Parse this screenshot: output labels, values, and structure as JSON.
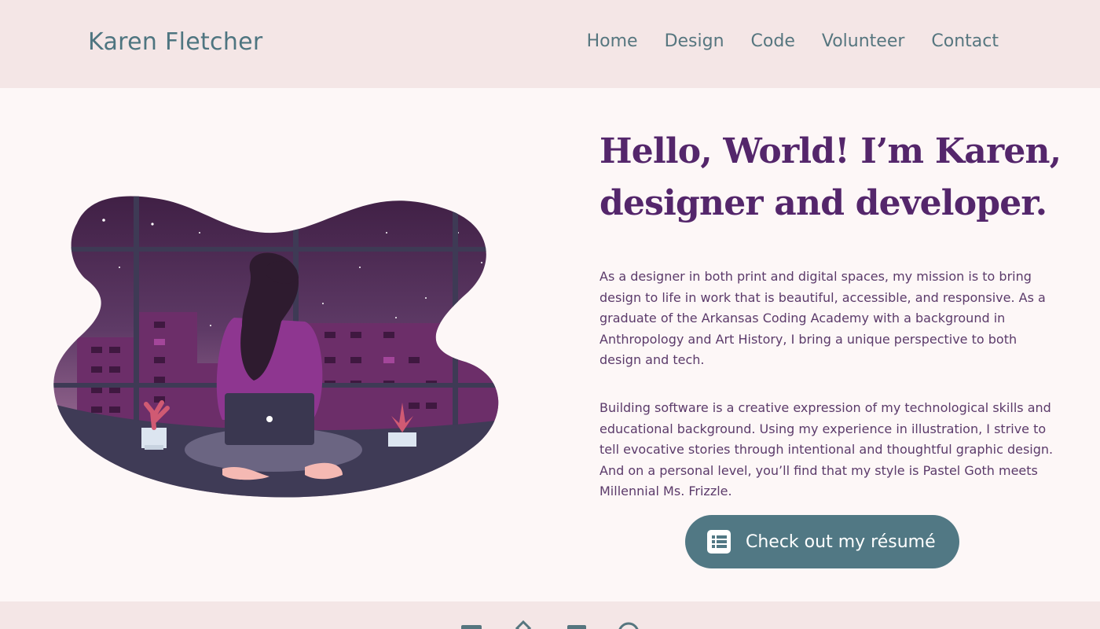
{
  "header": {
    "brand": "Karen Fletcher",
    "nav": [
      {
        "label": "Home"
      },
      {
        "label": "Design"
      },
      {
        "label": "Code"
      },
      {
        "label": "Volunteer"
      },
      {
        "label": "Contact"
      }
    ]
  },
  "hero": {
    "illustration": "woman-with-laptop-night-city-illustration",
    "title_line1": "Hello, World! I’m Karen,",
    "title_line2": "designer and developer.",
    "paragraph1": "As a designer in both print and digital spaces, my mission is to bring design to life in work that is beautiful, accessible, and responsive. As a graduate of the Arkansas Coding Academy with a background in Anthropology and Art History, I bring a unique perspective to both design and tech.",
    "paragraph2": "Building software is a creative expression of my technological skills and educational background. Using my experience in illustration, I strive to tell evocative stories through intentional and thoughtful graphic design. And on a personal level, you’ll find that my style is Pastel Goth meets Millennial Ms. Frizzle.",
    "resume_button": {
      "label": "Check out my résumé",
      "icon": "list-icon"
    }
  },
  "footer": {
    "social_icons": [
      "email-icon",
      "tag-icon",
      "linkedin-icon",
      "github-icon"
    ]
  },
  "colors": {
    "header_bg": "#f4e6e6",
    "page_bg": "#fdf7f7",
    "accent_teal": "#517884",
    "heading_purple": "#54266b",
    "body_text": "#5b3a6a"
  }
}
